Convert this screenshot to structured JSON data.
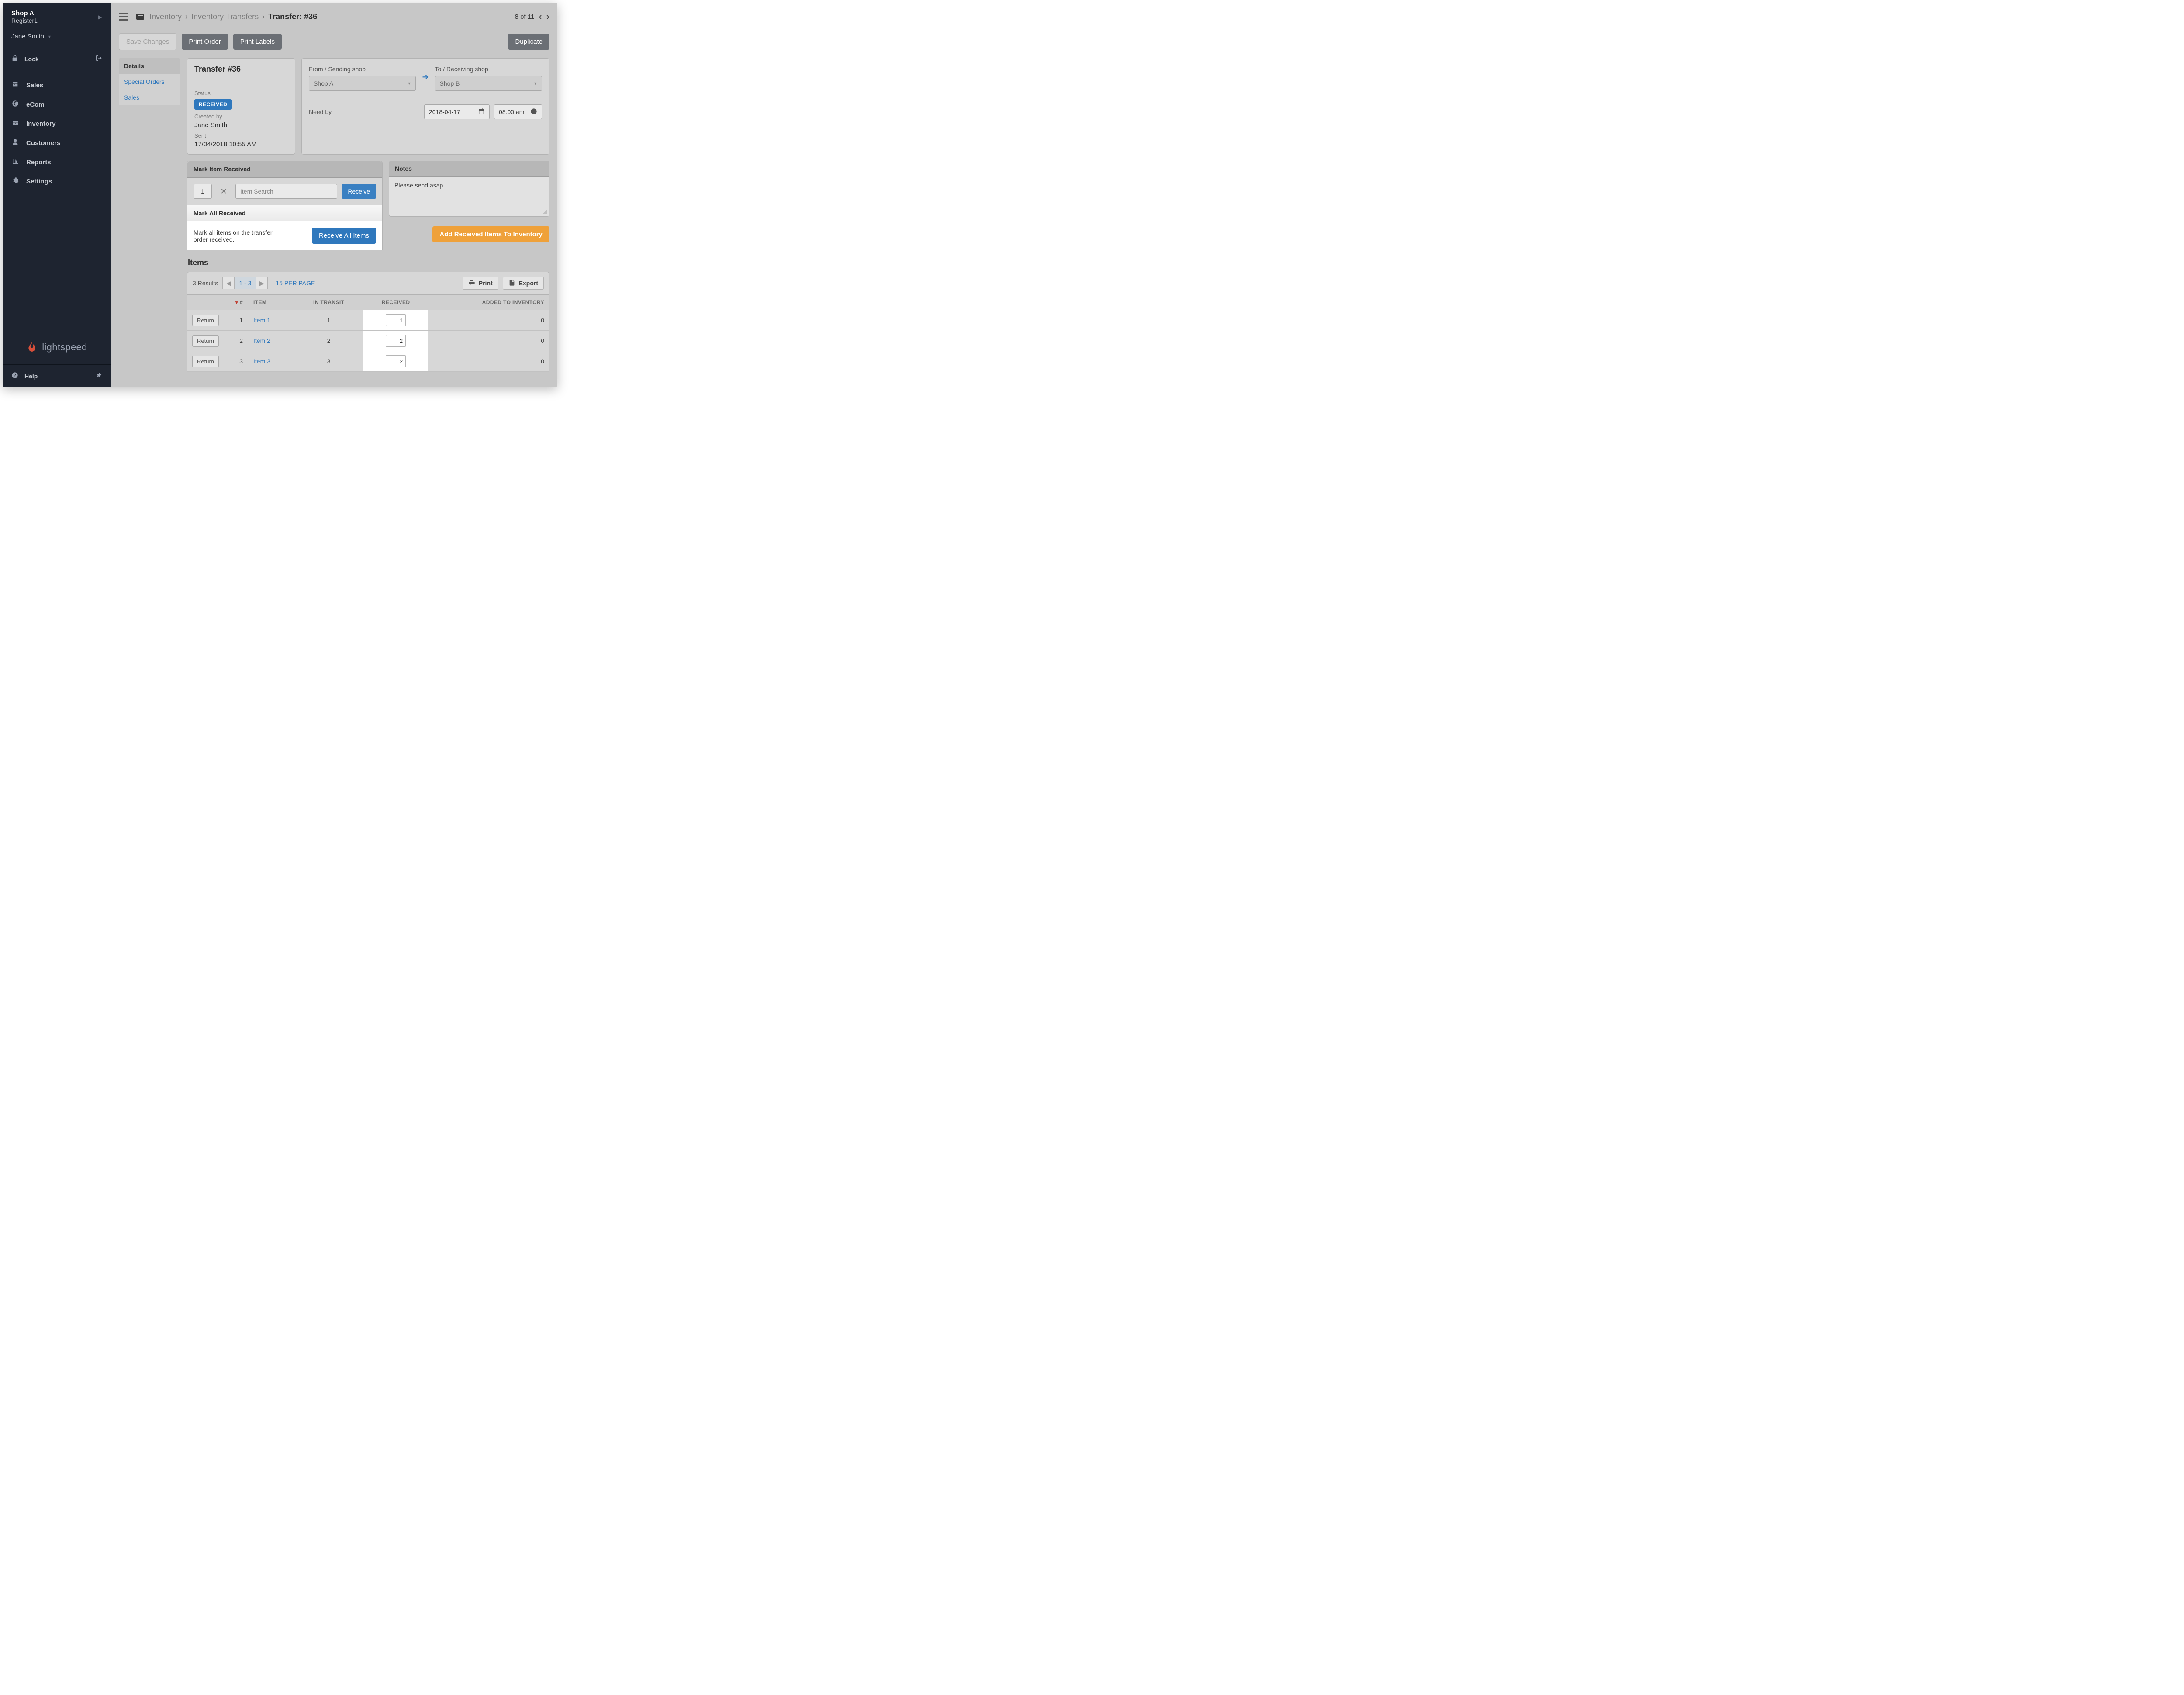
{
  "sidebar": {
    "shop": "Shop A",
    "register": "Register1",
    "user": "Jane Smith",
    "lock": "Lock",
    "items": [
      {
        "icon": "register",
        "label": "Sales"
      },
      {
        "icon": "globe",
        "label": "eCom"
      },
      {
        "icon": "drawer",
        "label": "Inventory"
      },
      {
        "icon": "user",
        "label": "Customers"
      },
      {
        "icon": "chart",
        "label": "Reports"
      },
      {
        "icon": "gear",
        "label": "Settings"
      }
    ],
    "brand": "lightspeed",
    "help": "Help"
  },
  "topbar": {
    "breadcrumbs": {
      "a": "Inventory",
      "b": "Inventory Transfers",
      "c": "Transfer: #36"
    },
    "pager": "8 of 11"
  },
  "actions": {
    "save": "Save Changes",
    "print_order": "Print Order",
    "print_labels": "Print Labels",
    "duplicate": "Duplicate"
  },
  "subtabs": {
    "details": "Details",
    "special": "Special Orders",
    "sales": "Sales"
  },
  "transfer": {
    "title": "Transfer #36",
    "status_label": "Status",
    "status_badge": "RECEIVED",
    "created_label": "Created by",
    "created_by": "Jane Smith",
    "sent_label": "Sent",
    "sent_value": "17/04/2018 10:55 AM"
  },
  "ship": {
    "from_label": "From / Sending shop",
    "to_label": "To / Receiving shop",
    "from_value": "Shop A",
    "to_value": "Shop B",
    "need_by": "Need by",
    "date": "2018-04-17",
    "time": "08:00 am"
  },
  "mark": {
    "title": "Mark Item Received",
    "qty": "1",
    "search_placeholder": "Item Search",
    "receive": "Receive",
    "all_title": "Mark All Received",
    "all_text": "Mark all items on the transfer order received.",
    "receive_all": "Receive All Items"
  },
  "notes": {
    "title": "Notes",
    "body": "Please send asap."
  },
  "add_inv": "Add Received Items To Inventory",
  "items": {
    "title": "Items",
    "results": "3 Results",
    "range": "1 - 3",
    "perpage": "15 PER PAGE",
    "print": "Print",
    "export": "Export",
    "headers": {
      "num": "#",
      "item": "ITEM",
      "transit": "IN TRANSIT",
      "received": "RECEIVED",
      "added": "ADDED TO INVENTORY"
    },
    "return_label": "Return",
    "rows": [
      {
        "num": "1",
        "item": "Item 1",
        "transit": "1",
        "received": "1",
        "added": "0"
      },
      {
        "num": "2",
        "item": "Item 2",
        "transit": "2",
        "received": "2",
        "added": "0"
      },
      {
        "num": "3",
        "item": "Item 3",
        "transit": "3",
        "received": "2",
        "added": "0"
      }
    ]
  }
}
